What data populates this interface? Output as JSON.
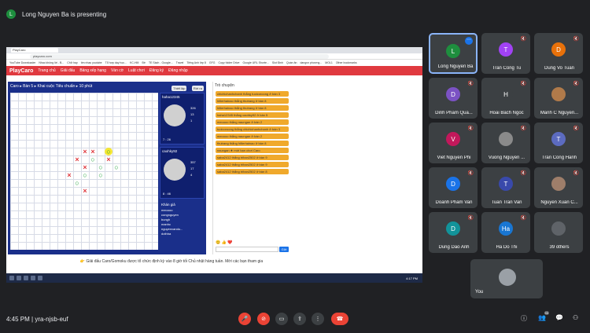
{
  "presenting": {
    "initial": "L",
    "text": "Long Nguyen Ba is presenting"
  },
  "browser": {
    "tabs": [
      "PlayCaro",
      "",
      "",
      "",
      ""
    ],
    "url": "playcaro.com",
    "bookmarks": [
      "YouTube Downloader",
      "Nhac không lời - B...",
      "Chữ hay",
      "tìm nhạc youtube",
      "Tổ hợp dạy học...",
      "KC-HM",
      "Đề",
      "TE Sách - Google...",
      "Travel",
      "Tiếng Anh lớp 8",
      "GFG",
      "Copy folder Drive",
      "Google URL Shorte...",
      "Slot Định",
      "Quán ăn",
      "dangvn phương...",
      "MOL1",
      "Other bookmarks"
    ]
  },
  "playcaro": {
    "logo": "PlayCaro",
    "nav": [
      "Trang chủ",
      "Giải đấu",
      "Bảng xếp hạng",
      "Ván cờ",
      "Luật chơi",
      "Đăng ký",
      "Đăng nhập"
    ],
    "crumb": "Caro ▸ Bàn 5 ▸ Khai cuộc Tiêu chuẩn ▸ 10 phút",
    "btn_practice": "Thiết lập",
    "btn_quit": "Rời ra",
    "players": [
      {
        "name": "haha12345",
        "stats": [
          "326",
          "13",
          "1"
        ],
        "time": "7 : 26"
      },
      {
        "name": "caohky92",
        "stats": [
          "357",
          "17",
          "4"
        ],
        "time": "8 : 46"
      }
    ],
    "spectators_title": "Khán giả",
    "spectators": [
      "meoooo",
      "congnguyen",
      "bungh",
      "manhc",
      "nguyenvandu...",
      "dothha"
    ],
    "chat_title": "Trò chuyện",
    "chat_messages": [
      "chichichanhchanh thắng tuoicoroong ở bàn 3",
      "hitlerhainao thắng thutrang ở bàn 8",
      "hitlerhainao thắng thutrang ở bàn 8",
      "haha12345 thắng caohky92 ở bàn 5",
      "meoooo thắng naungan ở bàn 2",
      "tuoicoroong thắng chichichanhchanh ở bàn 3",
      "meoooo thắng naungan ở bàn 2",
      "thutrang thắng hitlerhainao ở bàn 8",
      "naungan ★ mời bạn chơi Caro",
      "saba2412 thắng trihan2502 ở bàn 9",
      "saba2412 thắng trihan2502 ở bàn 9",
      "saba2412 thắng trihan2502 ở bàn 8"
    ],
    "chat_send": "Gửi",
    "banner": "👉 Giải đấu Caro/Gomoku được tổ chức định kỳ vào 8 giờ tối Chủ nhật hàng tuần. Mời các bạn tham gia"
  },
  "taskbar": {
    "clock": "4:17 PM"
  },
  "participants": [
    {
      "name": "Long Nguyen Ba",
      "initial": "L",
      "color": "#1e8e3e",
      "active": true,
      "photo": false
    },
    {
      "name": "Tran Cong Tu",
      "initial": "T",
      "color": "#a142f4",
      "photo": false
    },
    {
      "name": "Dung Vo Tuan",
      "initial": "D",
      "color": "#e8710a",
      "photo": false
    },
    {
      "name": "Dinh Pham Qua...",
      "initial": "D",
      "color": "#7b52c4",
      "photo": false
    },
    {
      "name": "Hoai Bach Ngoc",
      "initial": "H",
      "color": "#3c4043",
      "photo": false
    },
    {
      "name": "Manh C Nguyen...",
      "initial": "",
      "color": "#b07a4a",
      "photo": true
    },
    {
      "name": "Viet Nguyen Phi",
      "initial": "V",
      "color": "#c2185b",
      "photo": false
    },
    {
      "name": "Vuong Nguyen ...",
      "initial": "",
      "color": "#8a8a8a",
      "photo": true
    },
    {
      "name": "Tran Cong Hanh",
      "initial": "T",
      "color": "#5c6bc0",
      "photo": false
    },
    {
      "name": "Doanh Pham Van",
      "initial": "D",
      "color": "#1a73e8",
      "photo": false
    },
    {
      "name": "Tuan Tran Van",
      "initial": "T",
      "color": "#3949ab",
      "photo": false
    },
    {
      "name": "Nguyen Xuan C...",
      "initial": "",
      "color": "#9e7e6a",
      "photo": true
    },
    {
      "name": "Dung Dao Anh",
      "initial": "D",
      "color": "#12939a",
      "photo": false
    },
    {
      "name": "Ha Do Thi",
      "initial": "Ha",
      "color": "#1976d2",
      "photo": false
    },
    {
      "name": "39 others",
      "initial": "",
      "color": "#5f6368",
      "photo": true
    }
  ],
  "you": {
    "name": "You"
  },
  "bottom": {
    "time": "4:45 PM",
    "separator": "|",
    "meeting_code": "yra-njsb-euf",
    "people_count": "55"
  }
}
